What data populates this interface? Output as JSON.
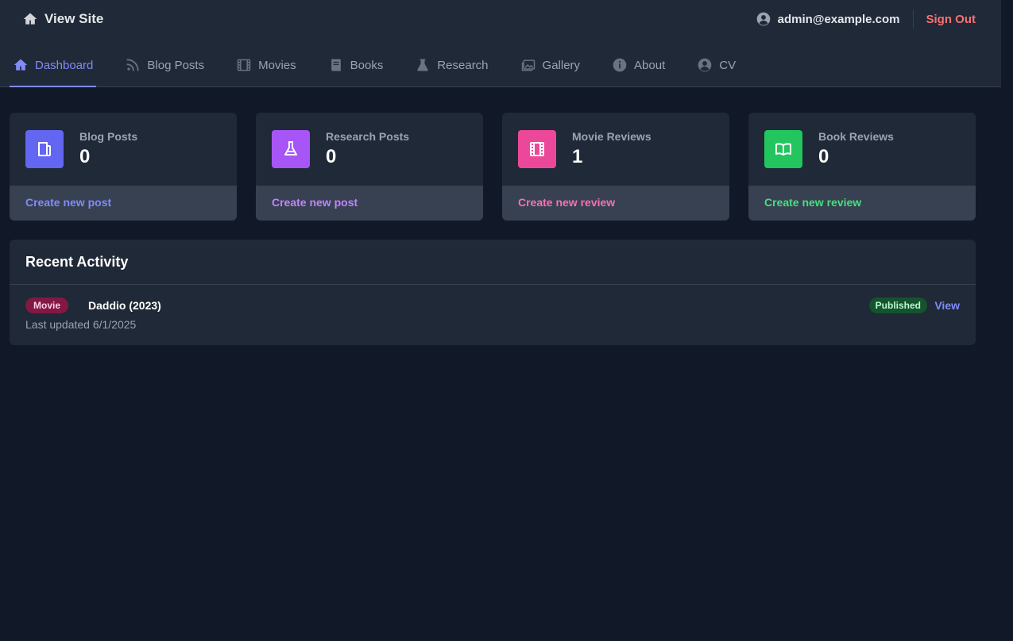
{
  "header": {
    "view_site": "View Site",
    "user_email": "admin@example.com",
    "sign_out": "Sign Out"
  },
  "nav": {
    "items": [
      {
        "label": "Dashboard",
        "icon": "home-icon",
        "active": true
      },
      {
        "label": "Blog Posts",
        "icon": "rss-icon"
      },
      {
        "label": "Movies",
        "icon": "film-icon"
      },
      {
        "label": "Books",
        "icon": "book-icon"
      },
      {
        "label": "Research",
        "icon": "beaker-icon"
      },
      {
        "label": "Gallery",
        "icon": "images-icon"
      },
      {
        "label": "About",
        "icon": "info-icon"
      },
      {
        "label": "CV",
        "icon": "user-circle-icon"
      }
    ]
  },
  "cards": [
    {
      "label": "Blog Posts",
      "count": "0",
      "action": "Create new post",
      "icon": "document-icon",
      "color": "#6366f1",
      "link_color": "#818cf8"
    },
    {
      "label": "Research Posts",
      "count": "0",
      "action": "Create new post",
      "icon": "beaker-icon",
      "color": "#a855f7",
      "link_color": "#c084fc"
    },
    {
      "label": "Movie Reviews",
      "count": "1",
      "action": "Create new review",
      "icon": "film-icon",
      "color": "#ec4899",
      "link_color": "#f472b6"
    },
    {
      "label": "Book Reviews",
      "count": "0",
      "action": "Create new review",
      "icon": "book-open-icon",
      "color": "#22c55e",
      "link_color": "#4ade80"
    }
  ],
  "activity": {
    "title": "Recent Activity",
    "items": [
      {
        "type": "Movie",
        "title": "Daddio (2023)",
        "updated": "Last updated 6/1/2025",
        "status": "Published",
        "action": "View"
      }
    ]
  }
}
